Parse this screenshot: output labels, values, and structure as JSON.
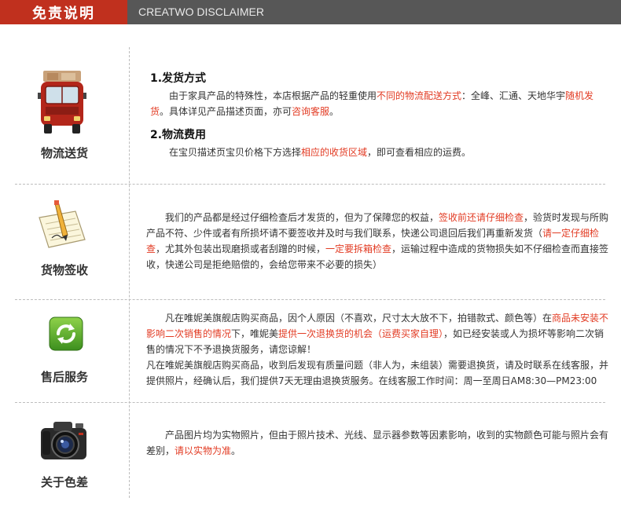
{
  "header": {
    "title": "免责说明",
    "subtitle": "CREATWO DISCLAIMER"
  },
  "sections": [
    {
      "label": "物流送货",
      "icon": "truck-icon",
      "h1": "1.发货方式",
      "p1": [
        {
          "t": "由于家具产品的特殊性，本店根据产品的轻重使用"
        },
        {
          "t": "不同的物流配送方式",
          "red": true
        },
        {
          "t": "：全峰、汇通、天地华宇"
        },
        {
          "t": "随机发货",
          "red": true
        },
        {
          "t": "。具体详见产品描述页面，亦可"
        },
        {
          "t": "咨询客服",
          "red": true
        },
        {
          "t": "。"
        }
      ],
      "h2": "2.物流费用",
      "p2": [
        {
          "t": "在宝贝描述页宝贝价格下方选择"
        },
        {
          "t": "相应的收货区域",
          "red": true
        },
        {
          "t": "，即可查看相应的运费。"
        }
      ]
    },
    {
      "label": "货物签收",
      "icon": "sign-document-icon",
      "p1": [
        {
          "t": "我们的产品都是经过仔细检查后才发货的，但为了保障您的权益，"
        },
        {
          "t": "签收前还请仔细检查",
          "red": true
        },
        {
          "t": "，验货时发现与所购产品不符、少件或者有所损坏请不要签收并及时与我们联系，快递公司退回后我们再重新发货（"
        },
        {
          "t": "请一定仔细检查",
          "red": true
        },
        {
          "t": "，尤其外包装出现磨损或者刮蹭的时候，"
        },
        {
          "t": "一定要拆箱检查",
          "red": true
        },
        {
          "t": "，运输过程中造成的货物损失如不仔细检查而直接签收，快递公司是拒绝赔偿的，会给您带来不必要的损失）"
        }
      ]
    },
    {
      "label": "售后服务",
      "icon": "refresh-icon",
      "p1": [
        {
          "t": "凡在唯妮美旗舰店购买商品，因个人原因（不喜欢，尺寸太大放不下，拍错款式、颜色等）在"
        },
        {
          "t": "商品未安装不影响二次销售的情况",
          "red": true
        },
        {
          "t": "下，唯妮美"
        },
        {
          "t": "提供一次退换货的机会（运费买家自理）",
          "red": true
        },
        {
          "t": "，如已经安装或人为损坏等影响二次销售的情况下不予退换货服务，请您谅解！"
        }
      ],
      "p2": [
        {
          "t": "凡在唯妮美旗舰店购买商品，收到后发现有质量问题（非人为，未组装）需要退换货，请及时联系在线客服，并提供照片，经确认后，我们提供7天无理由退换货服务。在线客服工作时间：周一至周日AM8:30—PM23:00"
        }
      ]
    },
    {
      "label": "关于色差",
      "icon": "camera-icon",
      "p1": [
        {
          "t": "产品图片均为实物照片，但由于照片技术、光线、显示器参数等因素影响，收到的实物颜色可能与照片会有差别，"
        },
        {
          "t": "请以实物为准",
          "red": true
        },
        {
          "t": "。"
        }
      ]
    }
  ]
}
